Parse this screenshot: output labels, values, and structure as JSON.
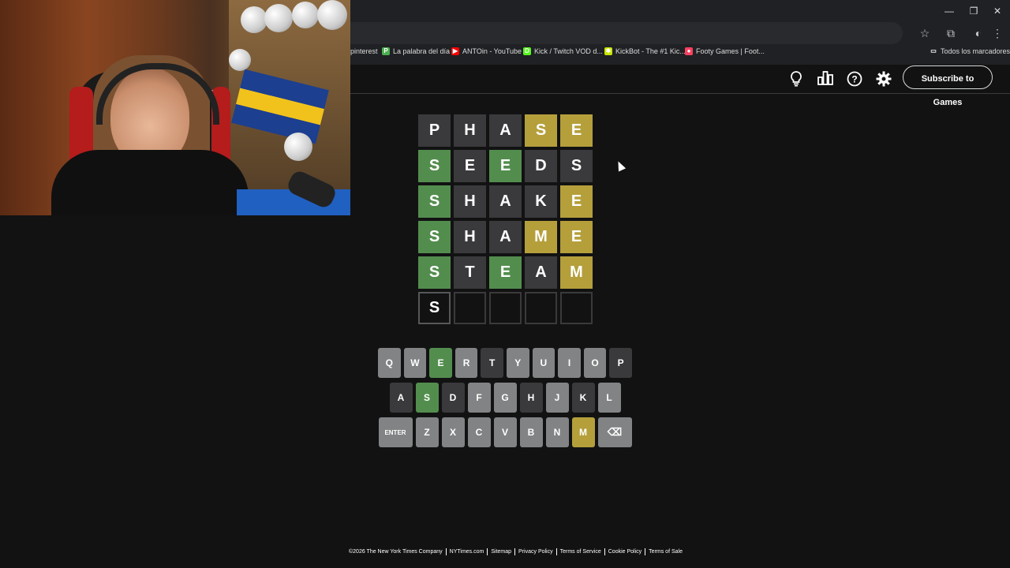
{
  "window_controls": {
    "minimize": "—",
    "restore": "❐",
    "close": "✕"
  },
  "toolbar": {
    "star_icon": "☆",
    "extensions_icon": "⧉",
    "profile_icon": "◐",
    "menu_icon": "⋮"
  },
  "bookmarks": [
    {
      "label": "pinterest",
      "icon_color": "#e60023",
      "icon_char": ""
    },
    {
      "label": "La palabra del día",
      "icon_color": "#4caf50",
      "icon_char": "P"
    },
    {
      "label": "ANTOin - YouTube",
      "icon_color": "#ff0000",
      "icon_char": "▶"
    },
    {
      "label": "Kick / Twitch VOD d...",
      "icon_color": "#53fc18",
      "icon_char": "D"
    },
    {
      "label": "KickBot - The #1 Kic...",
      "icon_color": "#c8e600",
      "icon_char": "✱"
    },
    {
      "label": "Footy Games | Foot...",
      "icon_color": "#ff4060",
      "icon_char": "●"
    },
    {
      "label": "Todos los marcadores",
      "icon_color": "#202124",
      "icon_char": "▭"
    }
  ],
  "header": {
    "hint_icon": "lightbulb-icon",
    "stats_icon": "stats-icon",
    "help_icon": "help-icon",
    "settings_icon": "gear-icon",
    "subscribe_label": "Subscribe to Games"
  },
  "board": [
    [
      {
        "l": "P",
        "s": "absent"
      },
      {
        "l": "H",
        "s": "absent"
      },
      {
        "l": "A",
        "s": "absent"
      },
      {
        "l": "S",
        "s": "present"
      },
      {
        "l": "E",
        "s": "present"
      }
    ],
    [
      {
        "l": "S",
        "s": "correct"
      },
      {
        "l": "E",
        "s": "absent"
      },
      {
        "l": "E",
        "s": "correct"
      },
      {
        "l": "D",
        "s": "absent"
      },
      {
        "l": "S",
        "s": "absent"
      }
    ],
    [
      {
        "l": "S",
        "s": "correct"
      },
      {
        "l": "H",
        "s": "absent"
      },
      {
        "l": "A",
        "s": "absent"
      },
      {
        "l": "K",
        "s": "absent"
      },
      {
        "l": "E",
        "s": "present"
      }
    ],
    [
      {
        "l": "S",
        "s": "correct"
      },
      {
        "l": "H",
        "s": "absent"
      },
      {
        "l": "A",
        "s": "absent"
      },
      {
        "l": "M",
        "s": "present"
      },
      {
        "l": "E",
        "s": "present"
      }
    ],
    [
      {
        "l": "S",
        "s": "correct"
      },
      {
        "l": "T",
        "s": "absent"
      },
      {
        "l": "E",
        "s": "correct"
      },
      {
        "l": "A",
        "s": "absent"
      },
      {
        "l": "M",
        "s": "present"
      }
    ],
    [
      {
        "l": "S",
        "s": "tbd"
      },
      {
        "l": "",
        "s": "empty"
      },
      {
        "l": "",
        "s": "empty"
      },
      {
        "l": "",
        "s": "empty"
      },
      {
        "l": "",
        "s": "empty"
      }
    ]
  ],
  "keyboard": [
    [
      {
        "k": "Q",
        "s": ""
      },
      {
        "k": "W",
        "s": ""
      },
      {
        "k": "E",
        "s": "correct"
      },
      {
        "k": "R",
        "s": ""
      },
      {
        "k": "T",
        "s": "absent"
      },
      {
        "k": "Y",
        "s": ""
      },
      {
        "k": "U",
        "s": ""
      },
      {
        "k": "I",
        "s": ""
      },
      {
        "k": "O",
        "s": ""
      },
      {
        "k": "P",
        "s": "absent"
      }
    ],
    [
      {
        "k": "A",
        "s": "absent"
      },
      {
        "k": "S",
        "s": "correct"
      },
      {
        "k": "D",
        "s": "absent"
      },
      {
        "k": "F",
        "s": ""
      },
      {
        "k": "G",
        "s": ""
      },
      {
        "k": "H",
        "s": "absent"
      },
      {
        "k": "J",
        "s": ""
      },
      {
        "k": "K",
        "s": "absent"
      },
      {
        "k": "L",
        "s": ""
      }
    ],
    [
      {
        "k": "ENTER",
        "s": "",
        "wide": true
      },
      {
        "k": "Z",
        "s": ""
      },
      {
        "k": "X",
        "s": ""
      },
      {
        "k": "C",
        "s": ""
      },
      {
        "k": "V",
        "s": ""
      },
      {
        "k": "B",
        "s": ""
      },
      {
        "k": "N",
        "s": ""
      },
      {
        "k": "M",
        "s": "present"
      },
      {
        "k": "⌫",
        "s": "",
        "wide": true
      }
    ]
  ],
  "footer": [
    "©2026 The New York Times Company",
    "NYTimes.com",
    "Sitemap",
    "Privacy Policy",
    "Terms of Service",
    "Cookie Policy",
    "Terms of Sale"
  ],
  "colors": {
    "correct": "#538d4e",
    "present": "#b59f3b",
    "absent": "#3a3a3c",
    "key_default": "#818384",
    "background": "#121213"
  }
}
